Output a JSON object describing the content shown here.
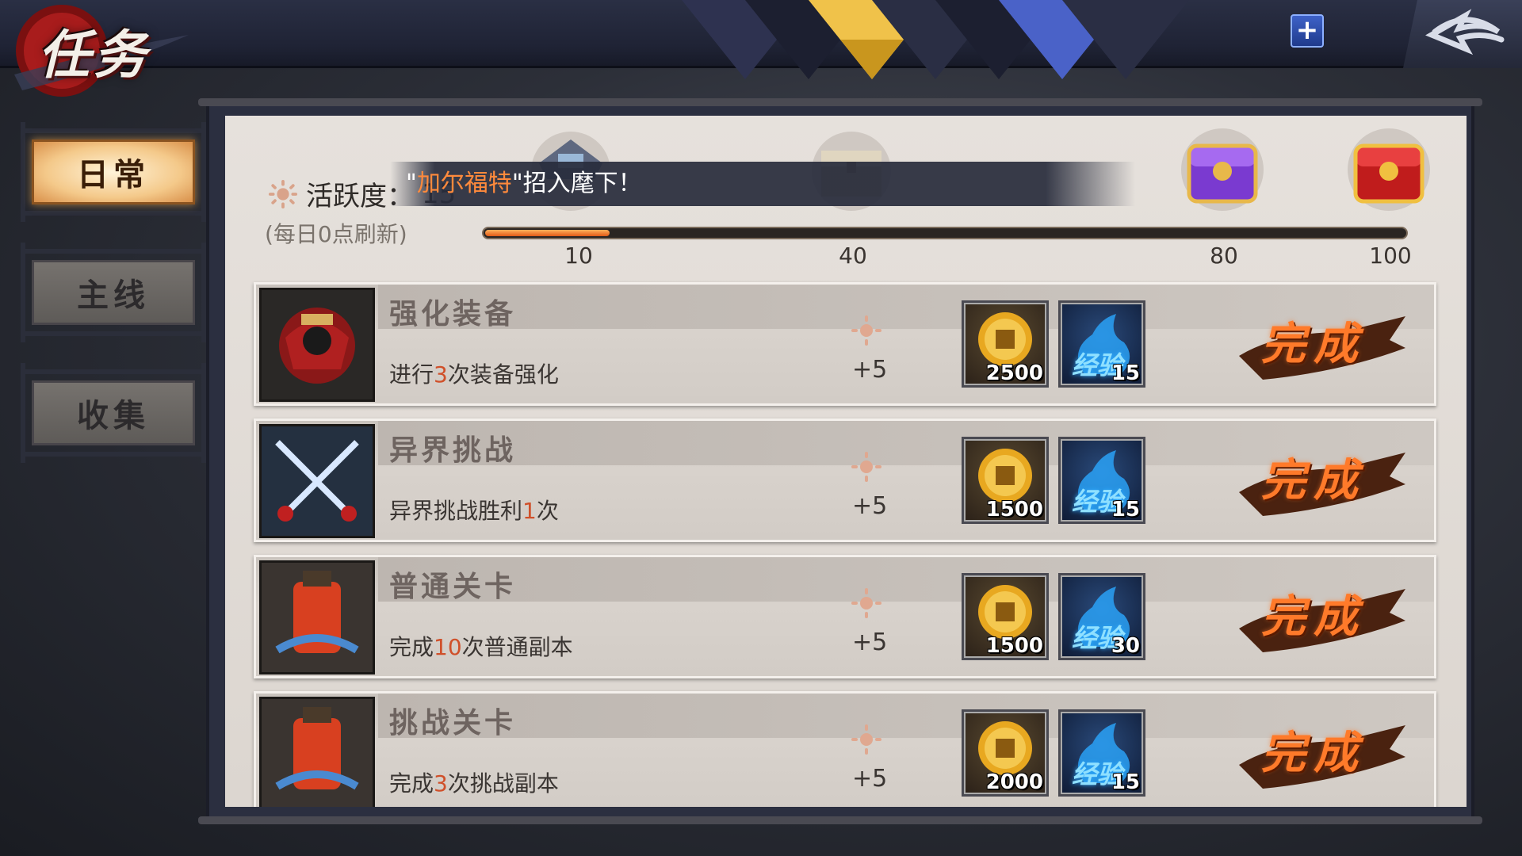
{
  "header": {
    "title": "任务",
    "plus_label": "+"
  },
  "sidebar": {
    "items": [
      {
        "label": "日常",
        "active": true
      },
      {
        "label": "主线",
        "active": false
      },
      {
        "label": "收集",
        "active": false
      }
    ]
  },
  "activity": {
    "label": "活跃度：",
    "value": "15",
    "refresh_note": "(每日0点刷新)",
    "banner_prefix": "\"",
    "banner_name": "加尔福特",
    "banner_suffix": "\"招入麾下！",
    "progress": 0.135,
    "milestones": [
      "10",
      "40",
      "80",
      "100"
    ]
  },
  "tasks": [
    {
      "name": "强化装备",
      "desc_pre": "进行",
      "desc_num": "3",
      "desc_post": "次装备强化",
      "points": "+5",
      "coin": "2500",
      "exp": "15",
      "exp_label": "经验",
      "status": "完成",
      "icon": "armor-icon"
    },
    {
      "name": "异界挑战",
      "desc_pre": "异界挑战胜利",
      "desc_num": "1",
      "desc_post": "次",
      "points": "+5",
      "coin": "1500",
      "exp": "15",
      "exp_label": "经验",
      "status": "完成",
      "icon": "crossed-swords-icon"
    },
    {
      "name": "普通关卡",
      "desc_pre": "完成",
      "desc_num": "10",
      "desc_post": "次普通副本",
      "points": "+5",
      "coin": "1500",
      "exp": "30",
      "exp_label": "经验",
      "status": "完成",
      "icon": "scroll-icon"
    },
    {
      "name": "挑战关卡",
      "desc_pre": "完成",
      "desc_num": "3",
      "desc_post": "次挑战副本",
      "points": "+5",
      "coin": "2000",
      "exp": "15",
      "exp_label": "经验",
      "status": "完成",
      "icon": "scroll-icon"
    }
  ],
  "colors": {
    "accent_orange": "#ff8a3c",
    "highlight_red": "#d0502a",
    "done_orange": "#ff7a2a"
  }
}
